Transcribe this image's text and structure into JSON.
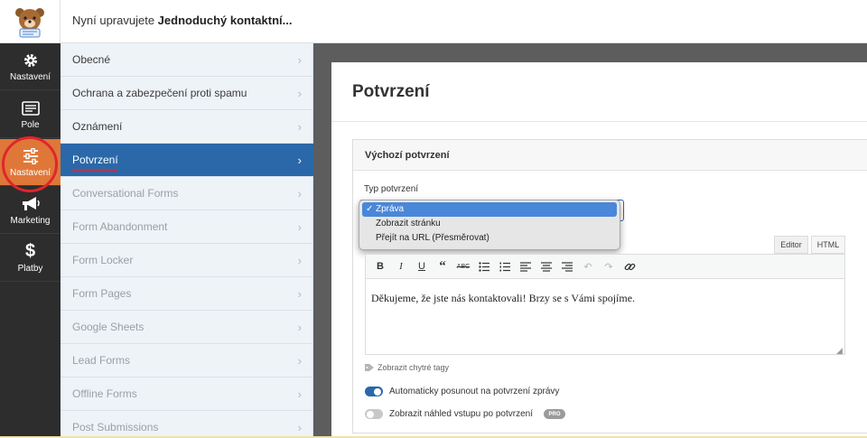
{
  "header": {
    "title_prefix": "Nyní upravujete ",
    "title_form": "Jednoduchý kontaktní...",
    "logo_icon": "bear-mascot-logo"
  },
  "rail": {
    "items": [
      {
        "label": "Nastavení",
        "icon": "gear-icon"
      },
      {
        "label": "Pole",
        "icon": "fields-icon"
      },
      {
        "label": "Nastavení",
        "icon": "sliders-icon",
        "active": true
      },
      {
        "label": "Marketing",
        "icon": "megaphone-icon"
      },
      {
        "label": "Platby",
        "icon": "dollar-icon"
      }
    ]
  },
  "submenu": {
    "items": [
      {
        "label": "Obecné"
      },
      {
        "label": "Ochrana a zabezpečení proti spamu"
      },
      {
        "label": "Oznámení"
      },
      {
        "label": "Potvrzení",
        "active": true
      },
      {
        "label": "Conversational Forms"
      },
      {
        "label": "Form Abandonment"
      },
      {
        "label": "Form Locker"
      },
      {
        "label": "Form Pages"
      },
      {
        "label": "Google Sheets"
      },
      {
        "label": "Lead Forms"
      },
      {
        "label": "Offline Forms"
      },
      {
        "label": "Post Submissions"
      }
    ]
  },
  "main": {
    "page_title": "Potvrzení",
    "panel_title": "Výchozí potvrzení",
    "type_label": "Typ potvrzení",
    "dropdown": {
      "options": [
        "Zpráva",
        "Zobrazit stránku",
        "Přejít na URL (Přesměrovat)"
      ],
      "selected": "Zpráva",
      "check": "✓"
    },
    "tabs": {
      "editor": "Editor",
      "html": "HTML"
    },
    "editor_text": "Děkujeme, že jste nás kontaktovali! Brzy se s Vámi spojíme.",
    "smart_tags": "Zobrazit chytré tagy",
    "toggle_scroll": {
      "label": "Automaticky posunout na potvrzení zprávy",
      "on": true
    },
    "toggle_preview": {
      "label": "Zobrazit náhled vstupu po potvrzení",
      "on": false,
      "badge": "PRO"
    }
  },
  "colors": {
    "accent_blue": "#2a68a9",
    "rail_active": "#df7739",
    "highlight_red": "#e0262b"
  }
}
